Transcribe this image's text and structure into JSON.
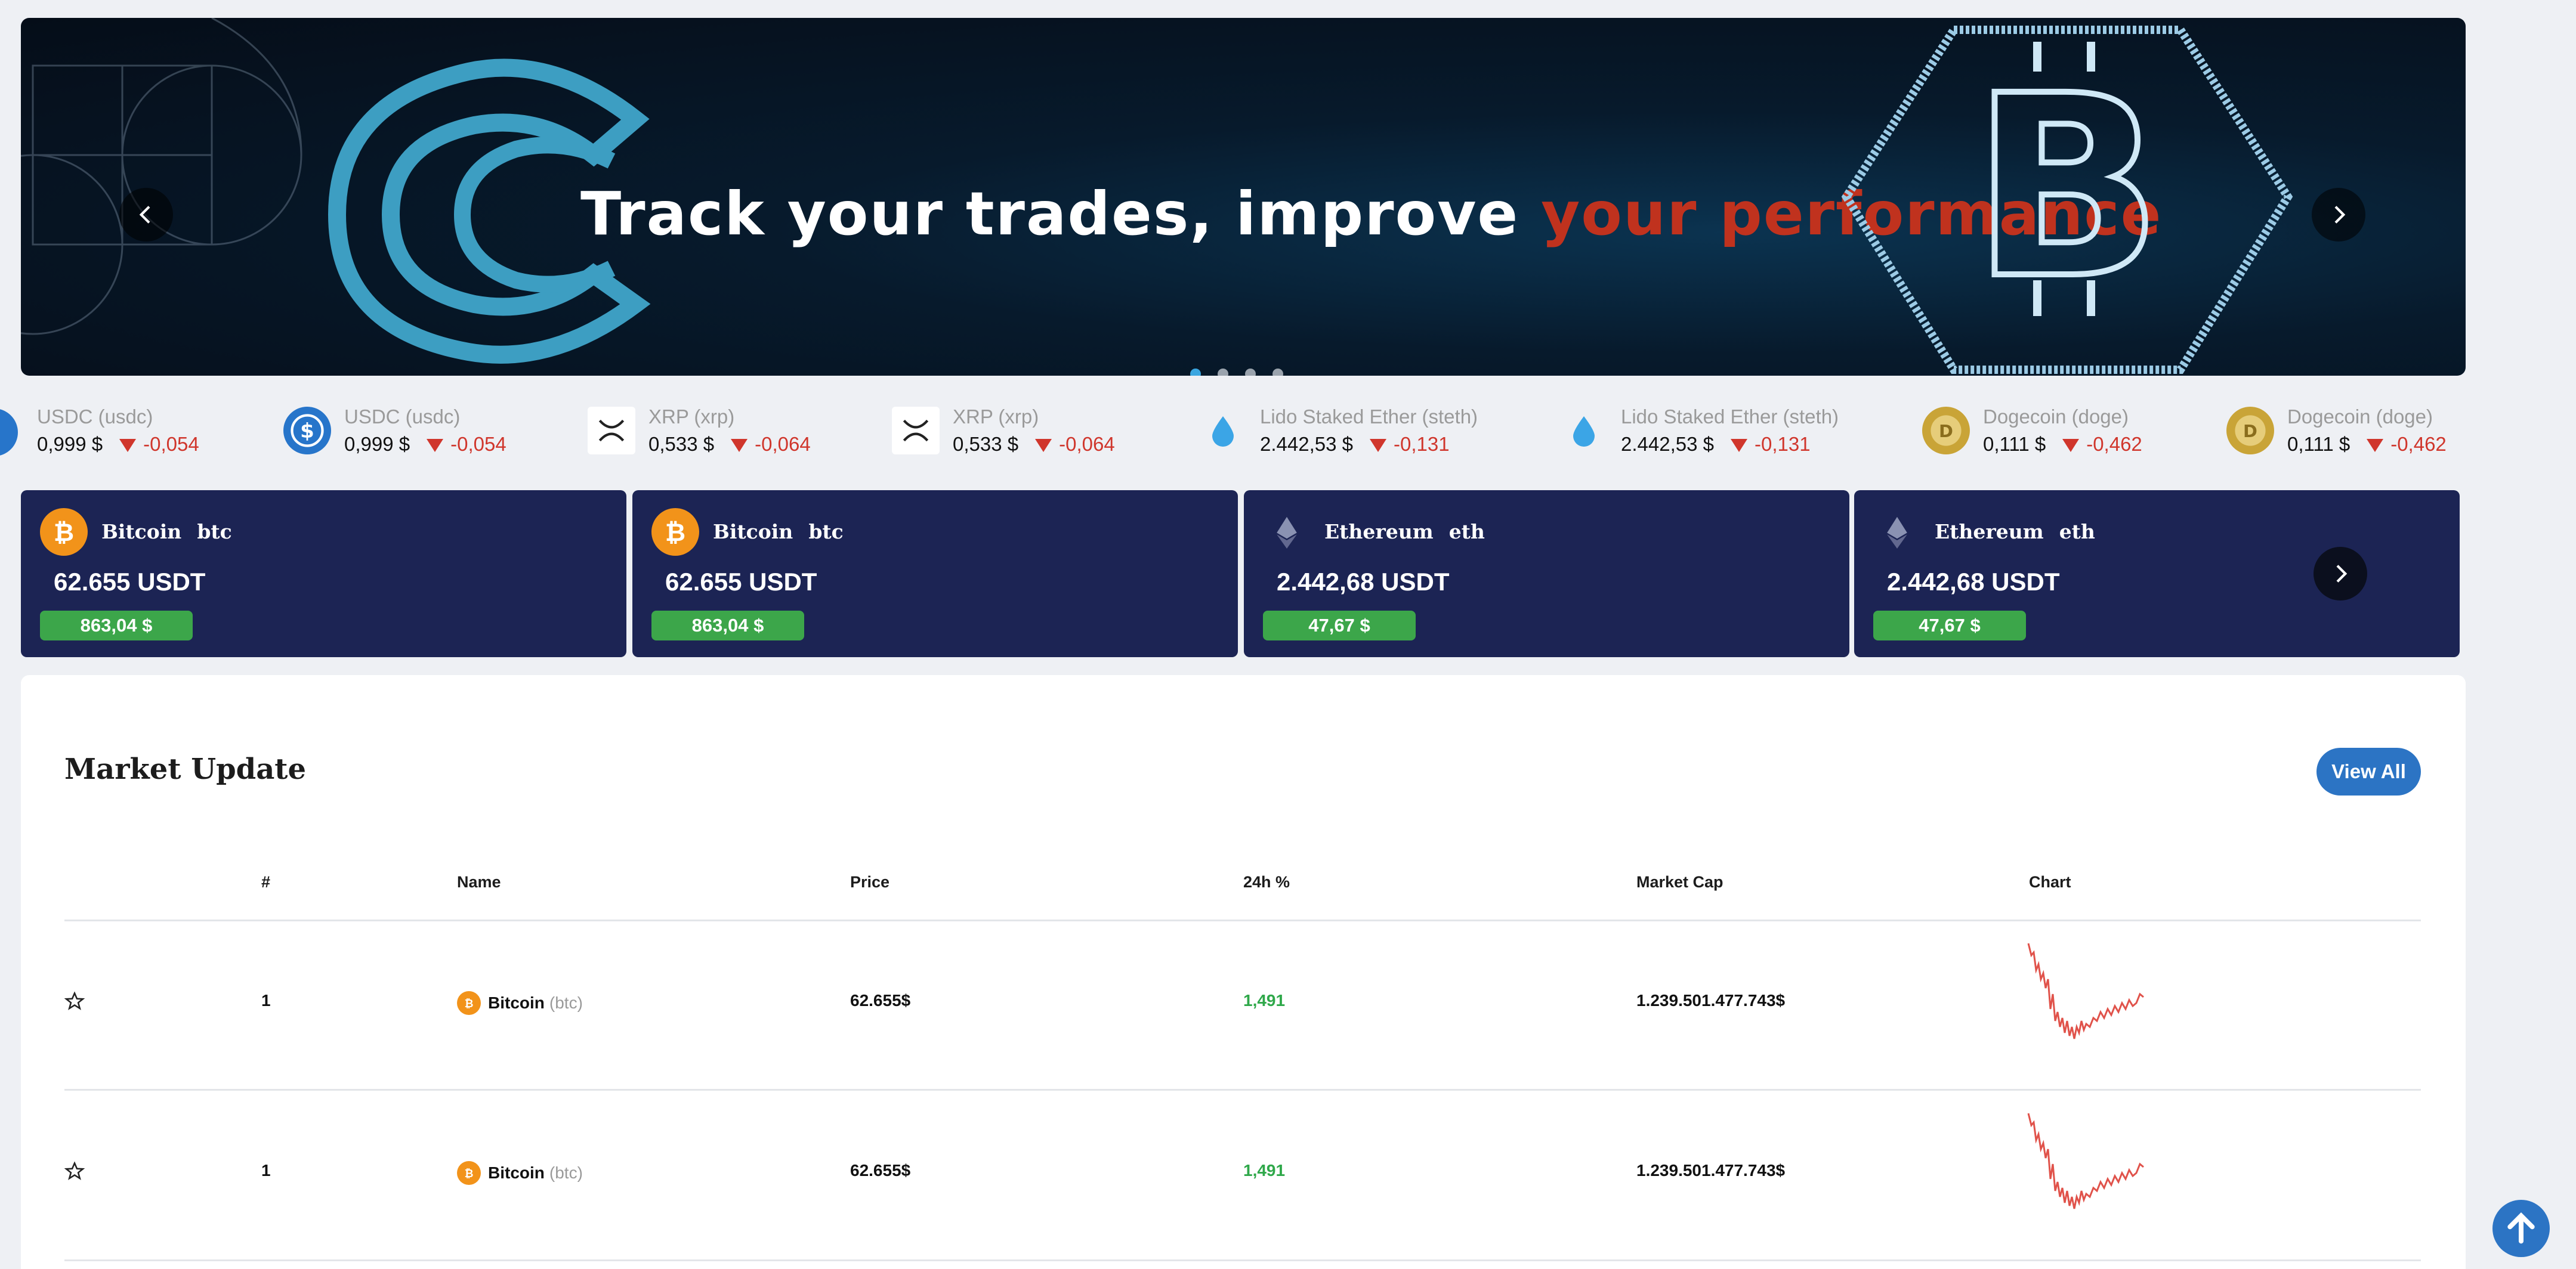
{
  "hero": {
    "headline_white": "Track your trades, improve",
    "headline_red": "your performance",
    "slide_count": 4,
    "active_slide": 1
  },
  "ticker": [
    {
      "name": "USDC (usdc)",
      "price": "0,999 $",
      "change": "-0,054",
      "icon": "usdc-icon"
    },
    {
      "name": "USDC (usdc)",
      "price": "0,999 $",
      "change": "-0,054",
      "icon": "usdc-icon"
    },
    {
      "name": "XRP (xrp)",
      "price": "0,533 $",
      "change": "-0,064",
      "icon": "xrp-icon"
    },
    {
      "name": "XRP (xrp)",
      "price": "0,533 $",
      "change": "-0,064",
      "icon": "xrp-icon"
    },
    {
      "name": "Lido Staked Ether (steth)",
      "price": "2.442,53 $",
      "change": "-0,131",
      "icon": "steth-drop-icon"
    },
    {
      "name": "Lido Staked Ether (steth)",
      "price": "2.442,53 $",
      "change": "-0,131",
      "icon": "steth-drop-icon"
    },
    {
      "name": "Dogecoin (doge)",
      "price": "0,111 $",
      "change": "-0,462",
      "icon": "doge-icon"
    },
    {
      "name": "Dogecoin (doge)",
      "price": "0,111 $",
      "change": "-0,462",
      "icon": "doge-icon"
    }
  ],
  "cards": [
    {
      "name": "Bitcoin",
      "symbol": "btc",
      "price": "62.655 USDT",
      "badge": "863,04 $",
      "icon": "bitcoin-icon"
    },
    {
      "name": "Bitcoin",
      "symbol": "btc",
      "price": "62.655 USDT",
      "badge": "863,04 $",
      "icon": "bitcoin-icon"
    },
    {
      "name": "Ethereum",
      "symbol": "eth",
      "price": "2.442,68 USDT",
      "badge": "47,67 $",
      "icon": "ethereum-icon"
    },
    {
      "name": "Ethereum",
      "symbol": "eth",
      "price": "2.442,68 USDT",
      "badge": "47,67 $",
      "icon": "ethereum-icon"
    }
  ],
  "market": {
    "title": "Market Update",
    "view_all": "View All",
    "columns": [
      "#",
      "Name",
      "Price",
      "24h %",
      "Market Cap",
      "Chart"
    ],
    "rows": [
      {
        "rank": "1",
        "name": "Bitcoin",
        "symbol": "(btc)",
        "price": "62.655$",
        "change": "1,491",
        "market_cap": "1.239.501.477.743$"
      },
      {
        "rank": "1",
        "name": "Bitcoin",
        "symbol": "(btc)",
        "price": "62.655$",
        "change": "1,491",
        "market_cap": "1.239.501.477.743$"
      }
    ]
  },
  "colors": {
    "card_bg": "#1c2454",
    "positive": "#3ca64a",
    "negative": "#d0362c",
    "accent_blue": "#2c74c4",
    "hero_accent": "#c0321e"
  }
}
